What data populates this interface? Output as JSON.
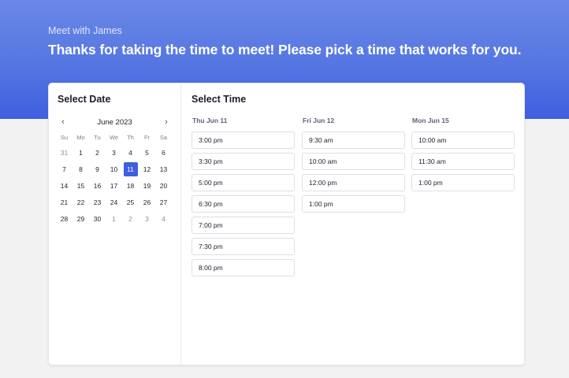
{
  "header": {
    "subtitle": "Meet with James",
    "title": "Thanks for taking the time to meet! Please pick a time that works for you."
  },
  "date_panel": {
    "title": "Select Date",
    "month_label": "June 2023",
    "weekdays": [
      "Su",
      "Mo",
      "Tu",
      "We",
      "Th",
      "Fr",
      "Sa"
    ],
    "weeks": [
      [
        "31",
        "1",
        "2",
        "3",
        "4",
        "5",
        "6"
      ],
      [
        "7",
        "8",
        "9",
        "10",
        "11",
        "12",
        "13"
      ],
      [
        "14",
        "15",
        "16",
        "17",
        "18",
        "19",
        "20"
      ],
      [
        "21",
        "22",
        "23",
        "24",
        "25",
        "26",
        "27"
      ],
      [
        "28",
        "29",
        "30",
        "1",
        "2",
        "3",
        "4"
      ]
    ],
    "selected_day": "11"
  },
  "time_panel": {
    "title": "Select Time",
    "days": [
      {
        "label": "Thu Jun 11",
        "slots": [
          "3:00 pm",
          "3:30 pm",
          "5:00 pm",
          "6:30 pm",
          "7:00 pm",
          "7:30 pm",
          "8:00 pm"
        ]
      },
      {
        "label": "Fri Jun 12",
        "slots": [
          "9:30 am",
          "10:00 am",
          "12:00 pm",
          "1:00 pm"
        ]
      },
      {
        "label": "Mon Jun 15",
        "slots": [
          "10:00 am",
          "11:30 am",
          "1:00 pm"
        ]
      }
    ]
  },
  "colors": {
    "accent": "#3f5fe0",
    "hero_gradient_top": "#6a88e6",
    "hero_gradient_bottom": "#3e5fe0"
  },
  "icons": {
    "prev_month": "chevron-left-icon",
    "next_month": "chevron-right-icon"
  }
}
